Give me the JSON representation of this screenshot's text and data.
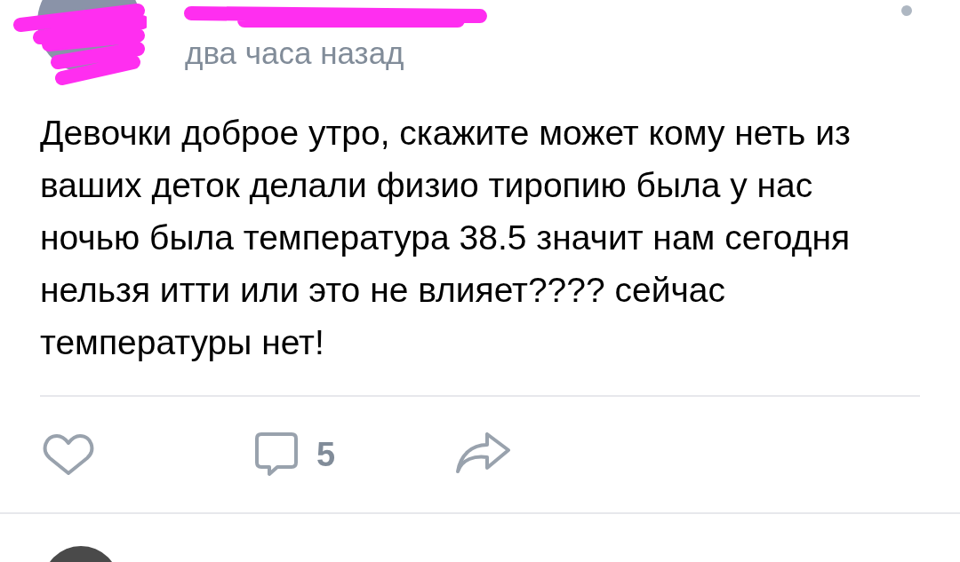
{
  "post": {
    "time": "два часа назад",
    "text": "Девочки доброе утро, скажите может кому неть из ваших деток делали физио тиропию была у нас ночью была температура 38.5 значит нам сегодня нельзя итти или это не влияет????  сейчас температуры нет!",
    "liked": false,
    "comments_count": "5"
  }
}
